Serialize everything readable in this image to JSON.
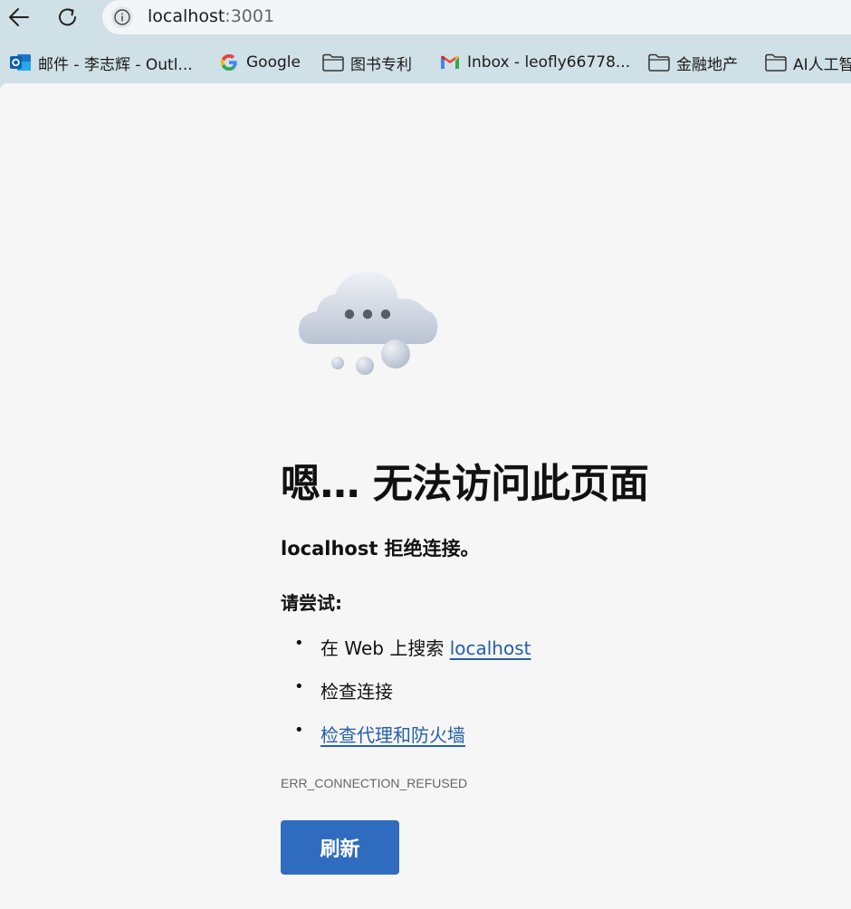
{
  "browser": {
    "url_host": "localhost",
    "url_port": ":3001",
    "icons": {
      "back": "back-arrow-icon",
      "reload": "reload-icon",
      "info": "info-icon"
    }
  },
  "bookmarks": [
    {
      "label": "邮件 - 李志辉 - Outl...",
      "icon": "outlook-icon"
    },
    {
      "label": "Google",
      "icon": "google-icon"
    },
    {
      "label": "图书专利",
      "icon": "folder-icon"
    },
    {
      "label": "Inbox - leofly66778...",
      "icon": "gmail-icon"
    },
    {
      "label": "金融地产",
      "icon": "folder-icon"
    },
    {
      "label": "AI人工智",
      "icon": "folder-icon"
    }
  ],
  "error_page": {
    "title": "嗯… 无法访问此页面",
    "host": "localhost",
    "refused_text": " 拒绝连接。",
    "try_label": "请尝试:",
    "suggestions": {
      "search_prefix": "在 Web 上搜索 ",
      "search_link": "localhost",
      "check_connection": "检查连接",
      "check_proxy": "检查代理和防火墙"
    },
    "error_code": "ERR_CONNECTION_REFUSED",
    "refresh_label": "刷新",
    "illustration": "cloud-icon"
  },
  "colors": {
    "chrome_bg": "#cfe0e6",
    "page_bg": "#f6f6f6",
    "link": "#2660a8",
    "button": "#2f6cbf"
  }
}
